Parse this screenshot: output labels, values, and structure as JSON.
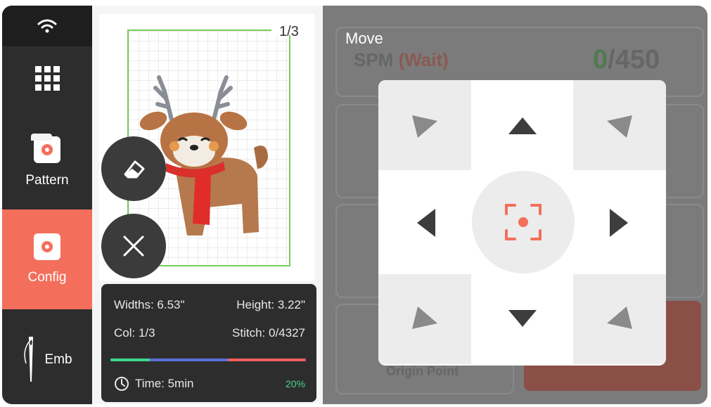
{
  "sidebar": {
    "items": [
      {
        "label": "Pattern",
        "icon": "pattern-icon"
      },
      {
        "label": "Config",
        "icon": "config-icon",
        "active": true
      },
      {
        "label": "Emb",
        "icon": "needle-icon"
      }
    ],
    "active_color": "#f36f5c"
  },
  "preview": {
    "counter": "1/3"
  },
  "info": {
    "widths": "Widths: 6.53\"",
    "height": "Height: 3.22\"",
    "col": "Col: 1/3",
    "stitch": "Stitch: 0/4327",
    "time": "Time: 5min",
    "percent": "20%",
    "progress_value": 0.2
  },
  "background": {
    "spm": "SPM",
    "wait": "(Wait)",
    "count_current": "0",
    "count_total": "/450",
    "origin_point": "Origin Point"
  },
  "move_dialog": {
    "title": "Move",
    "buttons": [
      "move-up-left",
      "move-up",
      "move-up-right",
      "move-left",
      "center",
      "move-right",
      "move-down-left",
      "move-down",
      "move-down-right"
    ]
  },
  "colors": {
    "accent": "#f36f5c",
    "hoop_border": "#7acb5a",
    "progress_done": "#3ed68c",
    "progress_mid": "#5b6fd6",
    "progress_rest": "#f05e5e"
  }
}
